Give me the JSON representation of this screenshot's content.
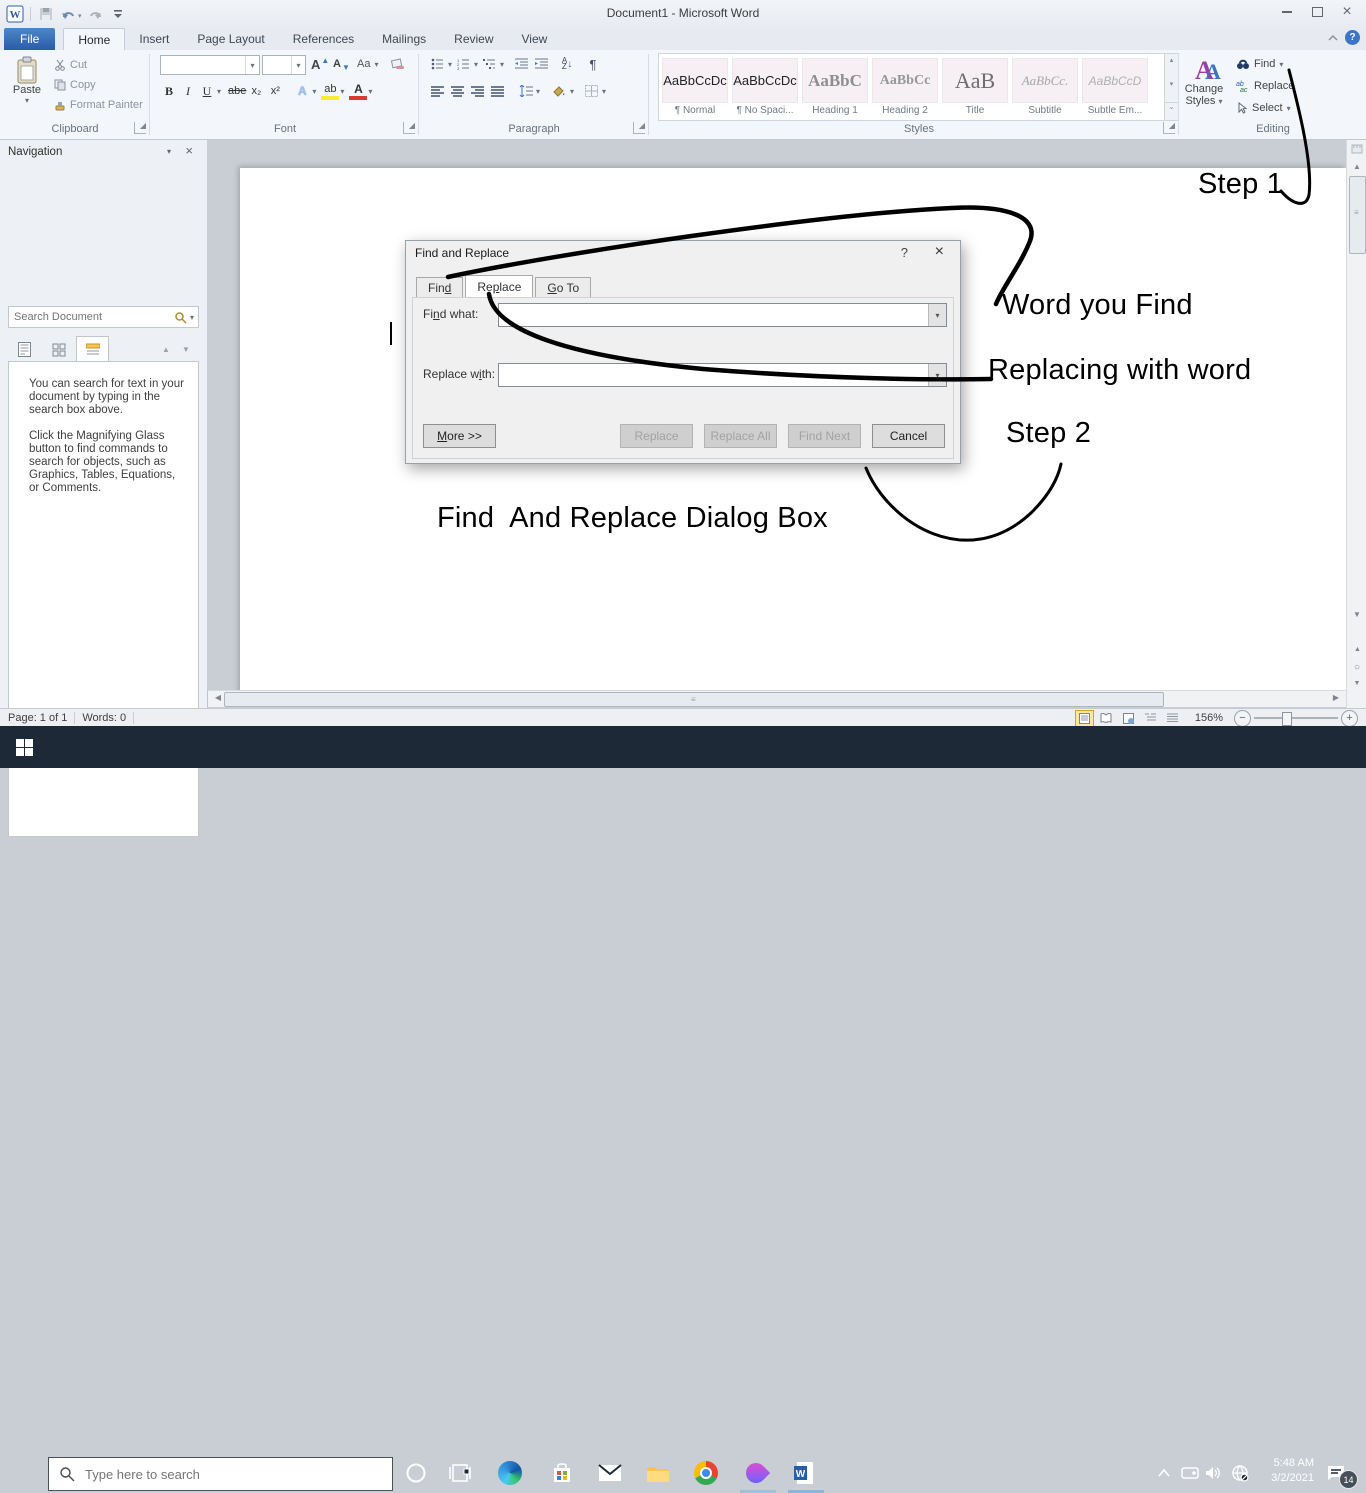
{
  "window": {
    "title": "Document1  -  Microsoft Word"
  },
  "glyphs": {
    "caret_down": "▾",
    "caret_up": "▴",
    "tri_up": "▲",
    "tri_down": "▼",
    "tri_left": "◀",
    "tri_right": "▶",
    "close": "×",
    "help": "?",
    "pilcrow": "¶",
    "grip_v": "≡",
    "circle": "○",
    "dbl_up": "▲▲",
    "dbl_down": "▼▼"
  },
  "colors": {
    "file_tab_blue": "#2a5ca8",
    "taskbar_bg": "#1d2936",
    "annotation_ink": "#000000",
    "active_app_underline": "#86b8e2",
    "help_icon_blue": "#3a76c4",
    "view_active_highlight": "#fbe6a6"
  },
  "ribbon": {
    "tabs": [
      {
        "label": "File"
      },
      {
        "label": "Home"
      },
      {
        "label": "Insert"
      },
      {
        "label": "Page Layout"
      },
      {
        "label": "References"
      },
      {
        "label": "Mailings"
      },
      {
        "label": "Review"
      },
      {
        "label": "View"
      }
    ],
    "clipboard": {
      "label": "Clipboard",
      "paste": "Paste",
      "cut": "Cut",
      "copy": "Copy",
      "format_painter": "Format Painter"
    },
    "font": {
      "label": "Font",
      "bold": "B",
      "italic": "I",
      "underline": "U",
      "strike": "abe",
      "subscript": "x₂",
      "superscript": "x²",
      "effects": "A",
      "highlight": "ab",
      "font_color": "A",
      "change_case": "Aa",
      "grow": "A",
      "shrink": "A"
    },
    "paragraph": {
      "label": "Paragraph",
      "sort_a": "A",
      "sort_z": "Z",
      "sort_arrow": "↓",
      "pilcrow": "¶"
    },
    "styles": {
      "label": "Styles",
      "change_line1": "Change",
      "change_line2": "Styles",
      "items": [
        {
          "sample": "AaBbCcDc",
          "name": "¶ Normal"
        },
        {
          "sample": "AaBbCcDc",
          "name": "¶ No Spaci..."
        },
        {
          "sample": "AaBbC",
          "name": "Heading 1"
        },
        {
          "sample": "AaBbCc",
          "name": "Heading 2"
        },
        {
          "sample": "AaB",
          "name": "Title"
        },
        {
          "sample": "AaBbCc.",
          "name": "Subtitle"
        },
        {
          "sample": "AaBbCcD",
          "name": "Subtle Em..."
        }
      ]
    },
    "editing": {
      "label": "Editing",
      "find": "Find",
      "replace": "Replace",
      "select": "Select"
    }
  },
  "navigation": {
    "title": "Navigation",
    "search_placeholder": "Search Document",
    "body_p1": "You can search for text in your document by typing in the search box above.",
    "body_p2": "Click the Magnifying Glass button to find commands to search for objects, such as Graphics, Tables, Equations, or Comments."
  },
  "dialog": {
    "title": "Find and Replace",
    "help": "?",
    "tabs": {
      "find": {
        "pre": "Fin",
        "accel": "d",
        "post": ""
      },
      "replace": {
        "pre": "Re",
        "accel": "p",
        "post": "lace"
      },
      "goto": {
        "pre": "",
        "accel": "G",
        "post": "o To"
      }
    },
    "find_what": {
      "pre": "Fi",
      "accel": "n",
      "post": "d what:"
    },
    "replace_with": {
      "pre": "Replace w",
      "accel": "i",
      "post": "th:"
    },
    "buttons": {
      "more": {
        "pre": "",
        "accel": "M",
        "post": "ore >>"
      },
      "replace": "Replace",
      "replace_all": "Replace All",
      "find_next": "Find Next",
      "cancel": "Cancel"
    }
  },
  "annotations": {
    "step1": "Step 1",
    "word_you_find": "Word you Find",
    "replacing_with_word": "Replacing with word",
    "step2": "Step 2",
    "caption": "Find  And Replace Dialog Box"
  },
  "status": {
    "page": "Page: 1 of 1",
    "words": "Words: 0",
    "zoom": "156%"
  },
  "taskbar": {
    "search_placeholder": "Type here to search",
    "time": "5:48 AM",
    "date": "3/2/2021",
    "badge": "14"
  }
}
